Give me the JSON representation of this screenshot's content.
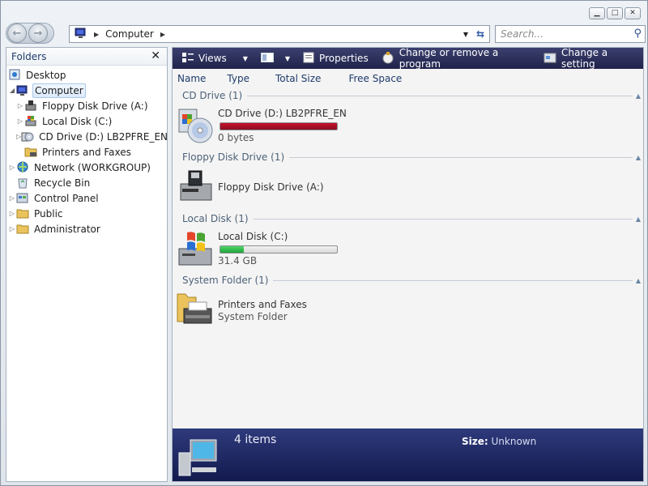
{
  "window": {
    "minimize_icon": "minimize-icon",
    "maximize_icon": "maximize-icon",
    "close_icon": "close-icon"
  },
  "address": {
    "path_item": "Computer",
    "search_placeholder": "Search..."
  },
  "folders": {
    "title": "Folders",
    "items": [
      {
        "label": "Desktop",
        "level": 0
      },
      {
        "label": "Computer",
        "level": 0,
        "selected": true
      },
      {
        "label": "Floppy Disk Drive (A:)",
        "level": 1
      },
      {
        "label": "Local Disk (C:)",
        "level": 1
      },
      {
        "label": "CD Drive (D:) LB2PFRE_EN",
        "level": 1
      },
      {
        "label": "Printers and Faxes",
        "level": 1
      },
      {
        "label": "Network (WORKGROUP)",
        "level": 0
      },
      {
        "label": "Recycle Bin",
        "level": 0
      },
      {
        "label": "Control Panel",
        "level": 0
      },
      {
        "label": "Public",
        "level": 0
      },
      {
        "label": "Administrator",
        "level": 0
      }
    ]
  },
  "toolbar": {
    "views": "Views",
    "properties": "Properties",
    "change_program": "Change or remove a program",
    "change_setting": "Change a setting"
  },
  "columns": [
    "Name",
    "Type",
    "Total Size",
    "Free Space"
  ],
  "groups": {
    "cd": {
      "title": "CD Drive (1)",
      "name": "CD Drive (D:) LB2PFRE_EN",
      "sub": "0 bytes",
      "used_fraction": 1.0
    },
    "floppy": {
      "title": "Floppy Disk Drive (1)",
      "name": "Floppy Disk Drive (A:)"
    },
    "local": {
      "title": "Local Disk (1)",
      "name": "Local Disk (C:)",
      "sub": "31.4 GB",
      "used_fraction": 0.2
    },
    "system": {
      "title": "System Folder (1)",
      "name": "Printers and Faxes",
      "sub": "System Folder"
    }
  },
  "details": {
    "count": "4 items",
    "size_label": "Size:",
    "size_value": "Unknown"
  },
  "colors": {
    "toolbar": "#2b2f5c",
    "cd_bar": "#c8102e",
    "disk_bar": "#22a33a",
    "details_bg": "#1d2560"
  }
}
